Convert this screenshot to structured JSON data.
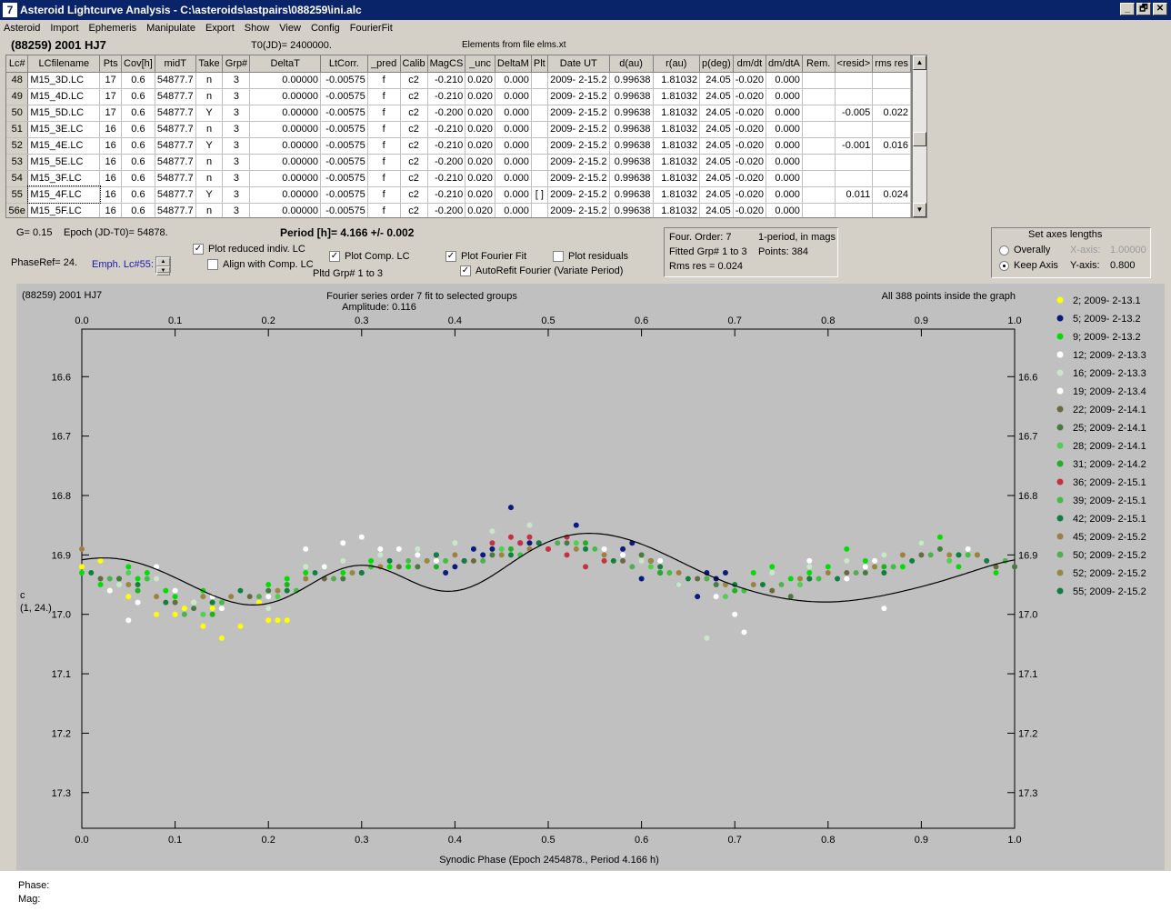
{
  "window": {
    "title": "Asteroid Lightcurve Analysis - C:\\asteroids\\astpairs\\088259\\ini.alc",
    "min": "_",
    "restore": "🗗",
    "close": "✕"
  },
  "menu": [
    "Asteroid",
    "Import",
    "Ephemeris",
    "Manipulate",
    "Export",
    "Show",
    "View",
    "Config",
    "FourierFit"
  ],
  "header": {
    "asteroid": "(88259) 2001 HJ7",
    "t0": "T0(JD)= 2400000.",
    "elements": "Elements from file elms.xt"
  },
  "table": {
    "columns": [
      "Lc#",
      "LCfilename",
      "Pts",
      "Cov[h]",
      "midT",
      "Take",
      "Grp#",
      "DeltaT",
      "LtCorr.",
      "_pred",
      "Calib",
      "MagCS",
      "_unc",
      "DeltaM",
      "Plt",
      "Date UT",
      "d(au)",
      "r(au)",
      "p(deg)",
      "dm/dt",
      "dm/dtA",
      "Rem.",
      "<resid>",
      "rms res"
    ],
    "rows": [
      [
        "48",
        "M15_3D.LC",
        "17",
        "0.6",
        "54877.7",
        "n",
        "3",
        "0.00000",
        "-0.00575",
        "f",
        "c2",
        "-0.210",
        "0.020",
        "0.000",
        "",
        "2009- 2-15.2",
        "0.99638",
        "1.81032",
        "24.05",
        "-0.020",
        "0.000",
        "",
        "",
        ""
      ],
      [
        "49",
        "M15_4D.LC",
        "17",
        "0.6",
        "54877.7",
        "n",
        "3",
        "0.00000",
        "-0.00575",
        "f",
        "c2",
        "-0.210",
        "0.020",
        "0.000",
        "",
        "2009- 2-15.2",
        "0.99638",
        "1.81032",
        "24.05",
        "-0.020",
        "0.000",
        "",
        "",
        ""
      ],
      [
        "50",
        "M15_5D.LC",
        "17",
        "0.6",
        "54877.7",
        "Y",
        "3",
        "0.00000",
        "-0.00575",
        "f",
        "c2",
        "-0.200",
        "0.020",
        "0.000",
        "",
        "2009- 2-15.2",
        "0.99638",
        "1.81032",
        "24.05",
        "-0.020",
        "0.000",
        "",
        "-0.005",
        "0.022"
      ],
      [
        "51",
        "M15_3E.LC",
        "16",
        "0.6",
        "54877.7",
        "n",
        "3",
        "0.00000",
        "-0.00575",
        "f",
        "c2",
        "-0.210",
        "0.020",
        "0.000",
        "",
        "2009- 2-15.2",
        "0.99638",
        "1.81032",
        "24.05",
        "-0.020",
        "0.000",
        "",
        "",
        ""
      ],
      [
        "52",
        "M15_4E.LC",
        "16",
        "0.6",
        "54877.7",
        "Y",
        "3",
        "0.00000",
        "-0.00575",
        "f",
        "c2",
        "-0.210",
        "0.020",
        "0.000",
        "",
        "2009- 2-15.2",
        "0.99638",
        "1.81032",
        "24.05",
        "-0.020",
        "0.000",
        "",
        "-0.001",
        "0.016"
      ],
      [
        "53",
        "M15_5E.LC",
        "16",
        "0.6",
        "54877.7",
        "n",
        "3",
        "0.00000",
        "-0.00575",
        "f",
        "c2",
        "-0.200",
        "0.020",
        "0.000",
        "",
        "2009- 2-15.2",
        "0.99638",
        "1.81032",
        "24.05",
        "-0.020",
        "0.000",
        "",
        "",
        ""
      ],
      [
        "54",
        "M15_3F.LC",
        "16",
        "0.6",
        "54877.7",
        "n",
        "3",
        "0.00000",
        "-0.00575",
        "f",
        "c2",
        "-0.210",
        "0.020",
        "0.000",
        "",
        "2009- 2-15.2",
        "0.99638",
        "1.81032",
        "24.05",
        "-0.020",
        "0.000",
        "",
        "",
        ""
      ],
      [
        "55",
        "M15_4F.LC",
        "16",
        "0.6",
        "54877.7",
        "Y",
        "3",
        "0.00000",
        "-0.00575",
        "f",
        "c2",
        "-0.210",
        "0.020",
        "0.000",
        "[ ]",
        "2009- 2-15.2",
        "0.99638",
        "1.81032",
        "24.05",
        "-0.020",
        "0.000",
        "",
        "0.011",
        "0.024"
      ],
      [
        "56e",
        "M15_5F.LC",
        "16",
        "0.6",
        "54877.7",
        "n",
        "3",
        "0.00000",
        "-0.00575",
        "f",
        "c2",
        "-0.200",
        "0.020",
        "0.000",
        "",
        "2009- 2-15.2",
        "0.99638",
        "1.81032",
        "24.05",
        "-0.020",
        "0.000",
        "",
        "",
        ""
      ]
    ]
  },
  "controls": {
    "g": "G= 0.15",
    "epoch": "Epoch (JD-T0)= 54878.",
    "period": "Period [h]= 4.166 +/- 0.002",
    "phaseref": "PhaseRef= 24.",
    "emph": "Emph. Lc#55:",
    "plot_reduced": "Plot reduced indiv. LC",
    "align_comp": "Align with Comp. LC",
    "plot_comp": "Plot Comp. LC",
    "pltd_grp": "Pltd Grp#  1   to   3",
    "plot_fourier": "Plot Fourier Fit",
    "autorefit": "AutoRefit Fourier (Variate Period)",
    "plot_residuals": "Plot residuals",
    "four_order": "Four. Order:  7",
    "one_period": "1-period, in mags",
    "fitted": "Fitted Grp# 1 to 3",
    "points": "Points: 384",
    "rms": "Rms res    = 0.024",
    "axes_title": "Set axes lengths",
    "overally": "Overally",
    "keep_axis": "Keep Axis",
    "xaxis_label": "X-axis:",
    "xaxis_val": "1.00000",
    "yaxis_label": "Y-axis:",
    "yaxis_val": "0.800"
  },
  "status": {
    "phase": "Phase:",
    "mag": "Mag:"
  },
  "chart_data": {
    "type": "scatter",
    "title": "Fourier series order 7 fit to selected groups",
    "subtitle": "Amplitude: 0.116",
    "top_left": "(88259) 2001 HJ7",
    "top_right": "All 388 points inside the graph",
    "xlabel": "Synodic Phase (Epoch 2454878., Period 4.166 h)",
    "ylabel_lines": [
      "c",
      "(1, 24.)"
    ],
    "xlim": [
      0,
      1
    ],
    "ylim": [
      16.52,
      17.36
    ],
    "y_inverted": true,
    "xticks": [
      "0.0",
      "0.1",
      "0.2",
      "0.3",
      "0.4",
      "0.5",
      "0.6",
      "0.7",
      "0.8",
      "0.9",
      "1.0"
    ],
    "yticks": [
      "16.6",
      "16.7",
      "16.8",
      "16.9",
      "17.0",
      "17.1",
      "17.2",
      "17.3"
    ],
    "fit": {
      "mean": 16.935,
      "terms": [
        [
          0.0197,
          0.0014
        ],
        [
          -0.0316,
          -0.0136
        ],
        [
          -0.011,
          0.0147
        ],
        [
          -0.009,
          -0.0155
        ],
        [
          0.0073,
          -0.0014
        ],
        [
          -0.0012,
          0.0025
        ],
        [
          -0.0008,
          -0.0011
        ]
      ]
    },
    "series": [
      {
        "name": "2; 2009- 2-13.1",
        "color": "#ffff00",
        "x": [
          0.0,
          0.01,
          0.02,
          0.03,
          0.05,
          0.06,
          0.08,
          0.09,
          0.1,
          0.11,
          0.12,
          0.13,
          0.14,
          0.15,
          0.16,
          0.17,
          0.19,
          0.2,
          0.21,
          0.22
        ],
        "y": [
          16.92,
          16.93,
          16.91,
          16.96,
          16.97,
          16.95,
          17.0,
          16.98,
          17.0,
          16.99,
          16.98,
          17.02,
          16.99,
          17.04,
          16.97,
          17.02,
          16.98,
          17.01,
          17.01,
          17.01
        ]
      },
      {
        "name": "5; 2009- 2-13.2",
        "color": "#0a1a80",
        "x": [
          0.38,
          0.39,
          0.4,
          0.41,
          0.42,
          0.43,
          0.44,
          0.45,
          0.46,
          0.47,
          0.48,
          0.53,
          0.58,
          0.59,
          0.6,
          0.61,
          0.62,
          0.64,
          0.66,
          0.67,
          0.68,
          0.69
        ],
        "y": [
          16.9,
          16.93,
          16.92,
          16.91,
          16.89,
          16.9,
          16.89,
          16.89,
          16.82,
          16.88,
          16.88,
          16.85,
          16.89,
          16.88,
          16.94,
          16.91,
          16.93,
          16.95,
          16.97,
          16.93,
          16.94,
          16.93
        ]
      },
      {
        "name": "9; 2009- 2-13.2",
        "color": "#00e000",
        "x": [
          0.0,
          0.02,
          0.04,
          0.05,
          0.06,
          0.07,
          0.09,
          0.1,
          0.13,
          0.14,
          0.16,
          0.18,
          0.2,
          0.22,
          0.24,
          0.26,
          0.28,
          0.3,
          0.31,
          0.33,
          0.35,
          0.72,
          0.74,
          0.76,
          0.78,
          0.8,
          0.82,
          0.84,
          0.86,
          0.88,
          0.9,
          0.92,
          0.94,
          0.96,
          0.98,
          1.0
        ],
        "y": [
          16.93,
          16.95,
          16.94,
          16.92,
          16.94,
          16.93,
          16.96,
          16.97,
          16.96,
          16.98,
          16.97,
          16.97,
          16.95,
          16.94,
          16.93,
          16.92,
          16.93,
          16.93,
          16.91,
          16.92,
          16.92,
          16.93,
          16.92,
          16.94,
          16.93,
          16.92,
          16.89,
          16.91,
          16.93,
          16.92,
          16.88,
          16.87,
          16.92,
          16.9,
          16.93,
          16.92
        ]
      },
      {
        "name": "12; 2009- 2-13.3",
        "color": "#ffffff",
        "x": [
          0.03,
          0.05,
          0.08,
          0.1,
          0.12,
          0.14,
          0.17,
          0.18,
          0.2,
          0.24,
          0.26,
          0.28,
          0.3,
          0.32,
          0.34,
          0.36,
          0.38,
          0.56,
          0.58,
          0.62,
          0.68,
          0.7,
          0.71,
          0.78,
          0.82,
          0.84,
          0.86
        ],
        "y": [
          16.96,
          17.01,
          16.92,
          16.96,
          16.98,
          16.97,
          16.96,
          16.97,
          16.97,
          16.89,
          16.92,
          16.88,
          16.87,
          16.89,
          16.89,
          16.9,
          16.91,
          16.89,
          16.9,
          16.91,
          16.97,
          17.0,
          17.03,
          16.91,
          16.94,
          16.92,
          16.99
        ]
      },
      {
        "name": "16; 2009- 2-13.3",
        "color": "#c8e8c8",
        "x": [
          0.04,
          0.08,
          0.12,
          0.16,
          0.2,
          0.24,
          0.28,
          0.32,
          0.36,
          0.4,
          0.44,
          0.48,
          0.52,
          0.56,
          0.6,
          0.64,
          0.67,
          0.7,
          0.74,
          0.78,
          0.82,
          0.86,
          0.9,
          0.94
        ],
        "y": [
          16.95,
          16.94,
          16.98,
          16.97,
          16.99,
          16.92,
          16.91,
          16.9,
          16.89,
          16.88,
          16.86,
          16.85,
          16.87,
          16.9,
          16.91,
          16.95,
          17.04,
          16.95,
          16.93,
          16.92,
          16.91,
          16.9,
          16.88,
          16.9
        ]
      },
      {
        "name": "19; 2009- 2-13.4",
        "color": "#ffffff",
        "x": [
          0.06,
          0.15,
          0.25,
          0.35,
          0.45,
          0.55,
          0.65,
          0.75,
          0.85,
          0.95
        ],
        "y": [
          16.98,
          16.99,
          16.93,
          16.91,
          16.89,
          16.89,
          16.94,
          16.95,
          16.91,
          16.89
        ]
      },
      {
        "name": "22; 2009- 2-14.1",
        "color": "#6a6a40",
        "x": [
          0.02,
          0.1,
          0.18,
          0.26,
          0.34,
          0.42,
          0.5,
          0.58,
          0.66,
          0.74,
          0.82,
          0.9,
          0.98
        ],
        "y": [
          16.94,
          16.98,
          16.97,
          16.94,
          16.92,
          16.91,
          16.89,
          16.91,
          16.94,
          16.96,
          16.93,
          16.9,
          16.92
        ]
      },
      {
        "name": "25; 2009- 2-14.1",
        "color": "#4a7a40",
        "x": [
          0.04,
          0.12,
          0.2,
          0.28,
          0.36,
          0.44,
          0.52,
          0.6,
          0.68,
          0.76,
          0.84,
          0.92,
          1.0
        ],
        "y": [
          16.94,
          16.99,
          16.96,
          16.94,
          16.92,
          16.9,
          16.88,
          16.9,
          16.95,
          16.97,
          16.93,
          16.89,
          16.92
        ]
      },
      {
        "name": "28; 2009- 2-14.1",
        "color": "#50d050",
        "x": [
          0.05,
          0.13,
          0.21,
          0.29,
          0.37,
          0.45,
          0.53,
          0.61,
          0.69,
          0.77,
          0.85,
          0.93
        ],
        "y": [
          16.93,
          17.0,
          16.97,
          16.93,
          16.91,
          16.89,
          16.88,
          16.92,
          16.97,
          16.95,
          16.92,
          16.91
        ]
      },
      {
        "name": "31; 2009- 2-14.2",
        "color": "#20b020",
        "x": [
          0.06,
          0.14,
          0.22,
          0.3,
          0.38,
          0.46,
          0.54,
          0.62,
          0.7,
          0.78,
          0.86,
          0.94
        ],
        "y": [
          16.96,
          17.0,
          16.95,
          16.93,
          16.92,
          16.89,
          16.88,
          16.93,
          16.96,
          16.94,
          16.92,
          16.9
        ]
      },
      {
        "name": "36; 2009- 2-15.1",
        "color": "#c83040",
        "x": [
          0.44,
          0.46,
          0.47,
          0.48,
          0.49,
          0.5,
          0.52,
          0.54,
          0.56,
          0.52
        ],
        "y": [
          16.88,
          16.87,
          16.88,
          16.87,
          16.88,
          16.89,
          16.9,
          16.92,
          16.91,
          16.87
        ]
      },
      {
        "name": "39; 2009- 2-15.1",
        "color": "#40c040",
        "x": [
          0.07,
          0.15,
          0.23,
          0.31,
          0.39,
          0.47,
          0.55,
          0.63,
          0.71,
          0.79,
          0.87,
          0.95
        ],
        "y": [
          16.94,
          16.98,
          16.96,
          16.92,
          16.91,
          16.9,
          16.89,
          16.93,
          16.96,
          16.94,
          16.92,
          16.9
        ]
      },
      {
        "name": "42; 2009- 2-15.1",
        "color": "#108040",
        "x": [
          0.01,
          0.09,
          0.17,
          0.25,
          0.33,
          0.41,
          0.49,
          0.57,
          0.65,
          0.73,
          0.81,
          0.89,
          0.97
        ],
        "y": [
          16.93,
          16.98,
          16.96,
          16.93,
          16.91,
          16.91,
          16.88,
          16.91,
          16.94,
          16.95,
          16.94,
          16.91,
          16.91
        ]
      },
      {
        "name": "45; 2009- 2-15.2",
        "color": "#a08040",
        "x": [
          0.0,
          0.08,
          0.16,
          0.24,
          0.32,
          0.4,
          0.48,
          0.56,
          0.64,
          0.72,
          0.8,
          0.88,
          0.96
        ],
        "y": [
          16.89,
          16.97,
          16.97,
          16.94,
          16.92,
          16.9,
          16.89,
          16.9,
          16.93,
          16.95,
          16.93,
          16.9,
          16.9
        ]
      },
      {
        "name": "50; 2009- 2-15.2",
        "color": "#50b050",
        "x": [
          0.03,
          0.11,
          0.19,
          0.27,
          0.35,
          0.43,
          0.51,
          0.59,
          0.67,
          0.75,
          0.83,
          0.91,
          0.99
        ],
        "y": [
          16.94,
          17.0,
          16.97,
          16.94,
          16.91,
          16.91,
          16.88,
          16.92,
          16.94,
          16.95,
          16.93,
          16.9,
          16.91
        ]
      },
      {
        "name": "52; 2009- 2-15.2",
        "color": "#988840",
        "x": [
          0.05,
          0.13,
          0.21,
          0.29,
          0.37,
          0.45,
          0.53,
          0.61,
          0.69,
          0.77,
          0.85,
          0.93
        ],
        "y": [
          16.95,
          16.97,
          16.96,
          16.93,
          16.91,
          16.9,
          16.89,
          16.91,
          16.95,
          16.94,
          16.92,
          16.9
        ]
      },
      {
        "name": "55; 2009- 2-15.2",
        "color": "#108040",
        "x": [
          0.06,
          0.14,
          0.22,
          0.3,
          0.38,
          0.46,
          0.54,
          0.62,
          0.7,
          0.78,
          0.86,
          0.94
        ],
        "y": [
          16.95,
          16.98,
          16.96,
          16.93,
          16.9,
          16.9,
          16.89,
          16.92,
          16.95,
          16.94,
          16.93,
          16.9
        ]
      }
    ]
  }
}
